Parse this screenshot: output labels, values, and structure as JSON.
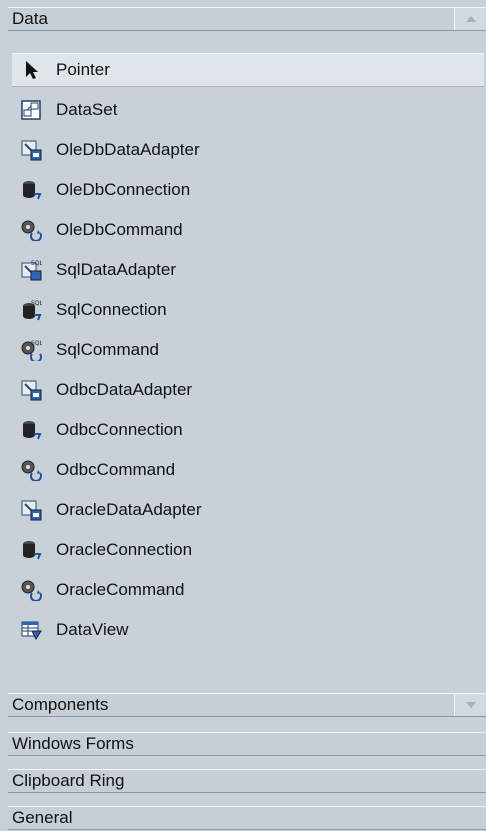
{
  "toolbox": {
    "active_tab": {
      "label": "Data",
      "items": [
        {
          "label": "Pointer",
          "icon": "pointer-icon",
          "selected": true
        },
        {
          "label": "DataSet",
          "icon": "dataset-icon"
        },
        {
          "label": "OleDbDataAdapter",
          "icon": "data-adapter-icon"
        },
        {
          "label": "OleDbConnection",
          "icon": "connection-icon"
        },
        {
          "label": "OleDbCommand",
          "icon": "command-icon"
        },
        {
          "label": "SqlDataAdapter",
          "icon": "sql-data-adapter-icon"
        },
        {
          "label": "SqlConnection",
          "icon": "sql-connection-icon"
        },
        {
          "label": "SqlCommand",
          "icon": "sql-command-icon"
        },
        {
          "label": "OdbcDataAdapter",
          "icon": "data-adapter-icon"
        },
        {
          "label": "OdbcConnection",
          "icon": "connection-icon"
        },
        {
          "label": "OdbcCommand",
          "icon": "command-icon"
        },
        {
          "label": "OracleDataAdapter",
          "icon": "data-adapter-icon"
        },
        {
          "label": "OracleConnection",
          "icon": "connection-icon"
        },
        {
          "label": "OracleCommand",
          "icon": "command-icon"
        },
        {
          "label": "DataView",
          "icon": "dataview-icon"
        }
      ]
    },
    "collapsed_tabs": [
      {
        "label": "Components"
      },
      {
        "label": "Windows Forms"
      },
      {
        "label": "Clipboard Ring"
      },
      {
        "label": "General"
      }
    ]
  }
}
